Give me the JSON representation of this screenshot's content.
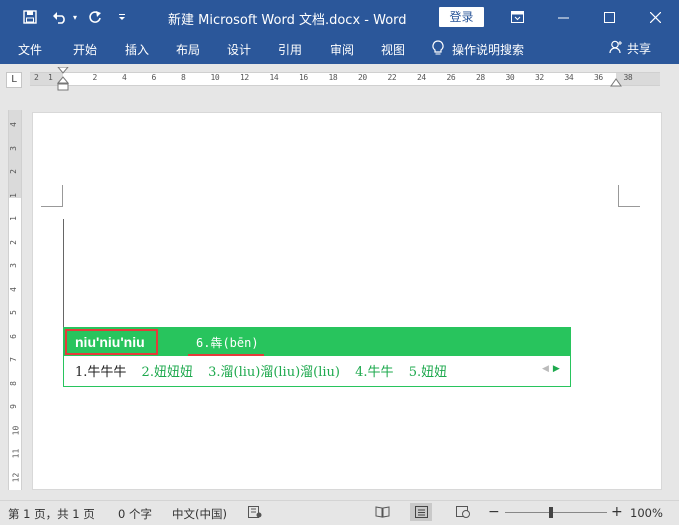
{
  "titlebar": {
    "title": "新建 Microsoft Word 文档.docx  -  Word",
    "login_label": "登录",
    "icons": [
      "save-icon",
      "undo-icon",
      "dropdown-icon",
      "redo-icon",
      "customize-toolbar-icon"
    ],
    "window_icons": [
      "ribbon-display-options-icon",
      "minimize-icon",
      "maximize-icon",
      "close-icon"
    ]
  },
  "ribbon": {
    "tabs": [
      "文件",
      "开始",
      "插入",
      "布局",
      "设计",
      "引用",
      "审阅",
      "视图"
    ],
    "tell_me": "操作说明搜索",
    "share": "共享"
  },
  "ruler": {
    "tab_selector": "L",
    "h_numbers": [
      "2",
      "1",
      "2",
      "4",
      "6",
      "8",
      "10",
      "12",
      "14",
      "16",
      "18",
      "20",
      "22",
      "24",
      "26",
      "28",
      "30",
      "32",
      "34",
      "36",
      "38"
    ],
    "v_numbers": [
      "4",
      "3",
      "2",
      "1",
      "1",
      "2",
      "3",
      "4",
      "5",
      "6",
      "7",
      "8",
      "9",
      "10",
      "11",
      "12"
    ]
  },
  "ime": {
    "pinyin": "niu'niu'niu",
    "hint": "6.犇(bēn)",
    "candidates": [
      "1.牛牛牛",
      "2.妞妞妞",
      "3.溜(liu)溜(liu)溜(liu)",
      "4.牛牛",
      "5.妞妞"
    ]
  },
  "status": {
    "page": "第 1 页，共 1 页",
    "words": "0 个字",
    "language": "中文(中国)",
    "zoom": "100%",
    "colors": {
      "title_bar": "#2b579a",
      "ime_green": "#28c45d",
      "highlight_red": "#e53a3a"
    }
  }
}
